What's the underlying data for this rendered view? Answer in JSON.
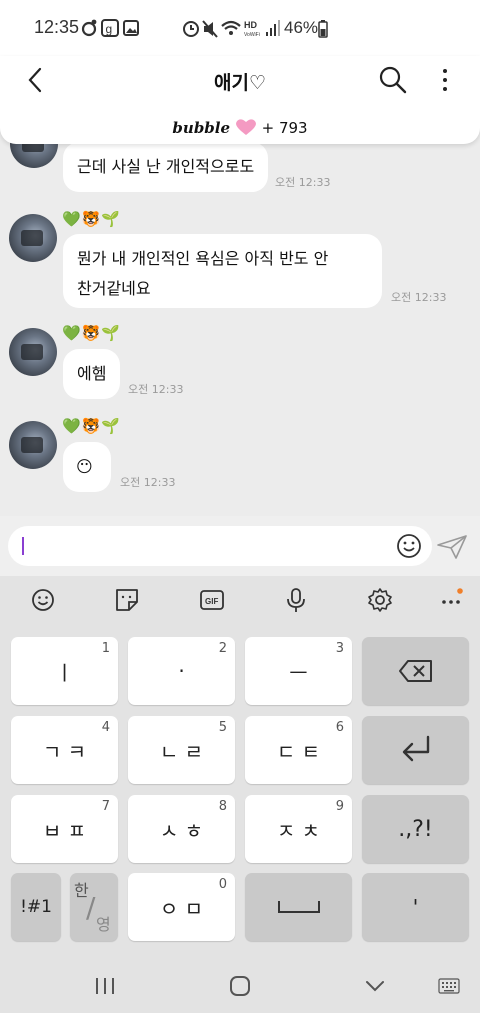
{
  "status_bar": {
    "time": "12:35",
    "battery_percent": "46%",
    "left_icons": [
      "threads-icon",
      "g-badge-icon",
      "image-icon"
    ],
    "right_icons": [
      "alarm-icon",
      "mute-icon",
      "wifi-icon",
      "hd-volte-icon",
      "signal-icon",
      "battery-icon"
    ],
    "hd_label": "HD",
    "volte_label": "VoWiFi"
  },
  "header": {
    "title": "애기♡",
    "bubble_label": "bubble",
    "heart_icon": "pink-heart-icon",
    "count": "+ 793"
  },
  "messages": [
    {
      "emoji": "",
      "text": "근데 사실 난 개인적으로도",
      "time": "오전 12:33"
    },
    {
      "emoji": "💚🐯🌱",
      "text_line1": "뭔가 내 개인적인 욕심은 아직 반도 안",
      "text_line2": "찬거같네요",
      "time": "오전 12:33"
    },
    {
      "emoji": "💚🐯🌱",
      "text": "에헴",
      "time": "오전 12:33"
    },
    {
      "emoji": "💚🐯🌱",
      "text": "😶",
      "time": "오전 12:33"
    }
  ],
  "input": {
    "placeholder": "",
    "emoji_icon": "smiley-icon",
    "send_icon": "paper-plane-icon"
  },
  "keyboard_toolbar": [
    "emoji-icon",
    "sticker-icon",
    "gif-icon",
    "mic-icon",
    "gear-icon",
    "more-icon"
  ],
  "keyboard_toolbar_gif": "GIF",
  "keys": {
    "r1": [
      {
        "num": "1",
        "label": "ㅣ"
      },
      {
        "num": "2",
        "label": "·"
      },
      {
        "num": "3",
        "label": "ㅡ"
      }
    ],
    "r2": [
      {
        "num": "4",
        "label": "ㄱ ㅋ"
      },
      {
        "num": "5",
        "label": "ㄴ ㄹ"
      },
      {
        "num": "6",
        "label": "ㄷ ㅌ"
      }
    ],
    "r3": [
      {
        "num": "7",
        "label": "ㅂ ㅍ"
      },
      {
        "num": "8",
        "label": "ㅅ ㅎ"
      },
      {
        "num": "9",
        "label": "ㅈ ㅊ"
      }
    ],
    "punct": ".,?!",
    "sym": "!#1",
    "han": "한",
    "slash": "/",
    "eng": "영",
    "zero_num": "0",
    "zero": "ㅇ ㅁ",
    "space": "␣",
    "apos": "'"
  },
  "nav": [
    "recents-icon",
    "home-icon",
    "back-chevron-icon",
    "keyboard-icon"
  ]
}
